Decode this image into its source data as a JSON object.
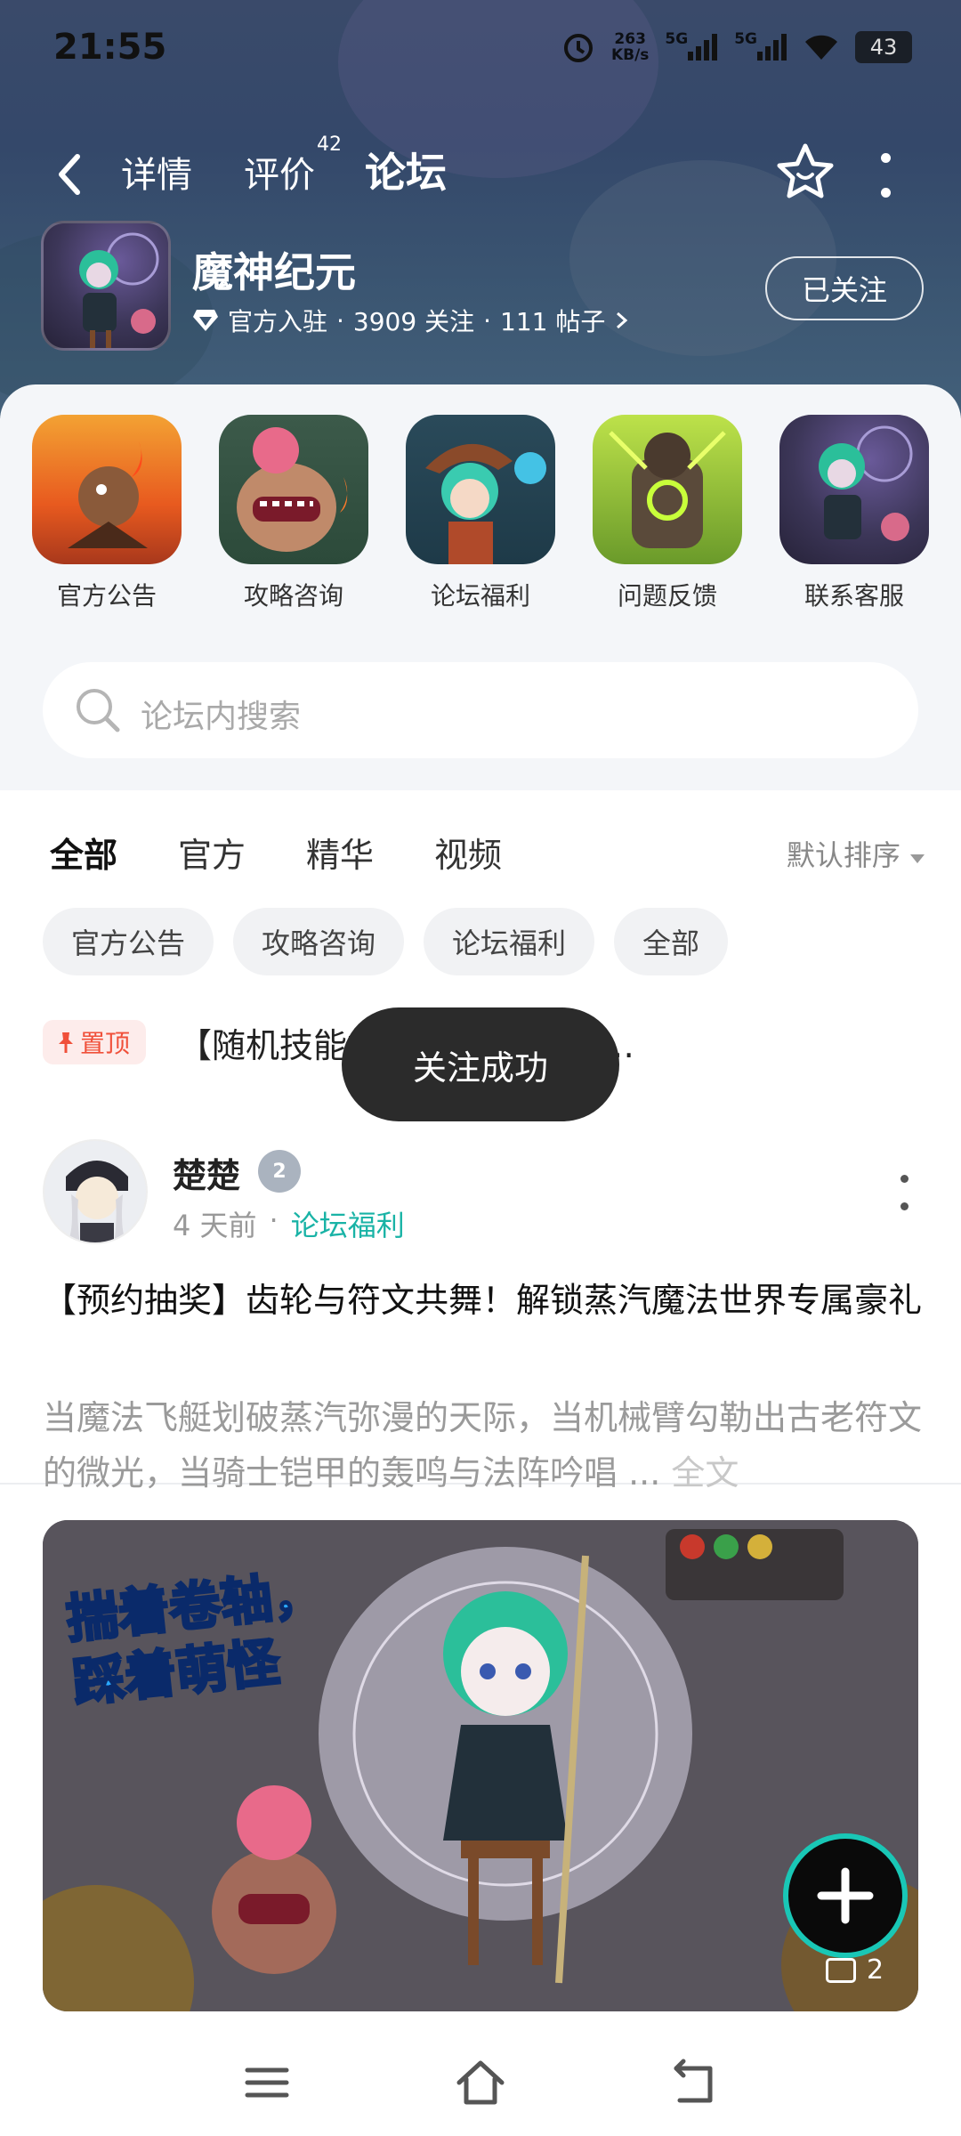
{
  "status_bar": {
    "time": "21:55",
    "net_speed_value": "263",
    "net_speed_unit": "KB/s",
    "signal1_label": "5G",
    "signal2_label": "5G",
    "battery": "43"
  },
  "nav": {
    "tabs": [
      {
        "label": "详情"
      },
      {
        "label": "评价",
        "badge": "42"
      },
      {
        "label": "论坛"
      }
    ]
  },
  "game": {
    "title": "魔神纪元",
    "meta_official": "官方入驻",
    "meta_follows": "3909 关注",
    "meta_posts": "111 帖子",
    "follow_button": "已关注"
  },
  "shortcuts": [
    {
      "label": "官方公告"
    },
    {
      "label": "攻略咨询"
    },
    {
      "label": "论坛福利"
    },
    {
      "label": "问题反馈"
    },
    {
      "label": "联系客服"
    }
  ],
  "search": {
    "placeholder": "论坛内搜索"
  },
  "feed_tabs": [
    {
      "label": "全部"
    },
    {
      "label": "官方"
    },
    {
      "label": "精华"
    },
    {
      "label": "视频"
    }
  ],
  "sort_label": "默认排序",
  "chips": [
    {
      "label": "官方公告"
    },
    {
      "label": "攻略咨询"
    },
    {
      "label": "论坛福利"
    },
    {
      "label": "全部"
    }
  ],
  "pinned": {
    "badge": "置顶",
    "title": "【随机技能机红色宝石宝箱*…"
  },
  "toast": "关注成功",
  "post": {
    "author": "楚楚",
    "level": "2",
    "time": "4 天前",
    "board": "论坛福利",
    "title": "【预约抽奖】齿轮与符文共舞！解锁蒸汽魔法世界专属豪礼",
    "excerpt": "当魔法飞艇划破蒸汽弥漫的天际，当机械臂勾勒出古老符文的微光，当骑士铠甲的轰鸣与法阵吟唱 ...",
    "read_more": "全文",
    "image_caption": "揣着卷轴，踩着萌怪",
    "image_count": "2"
  },
  "colors": {
    "accent": "#19c7b6",
    "pin_red": "#f0503a"
  }
}
